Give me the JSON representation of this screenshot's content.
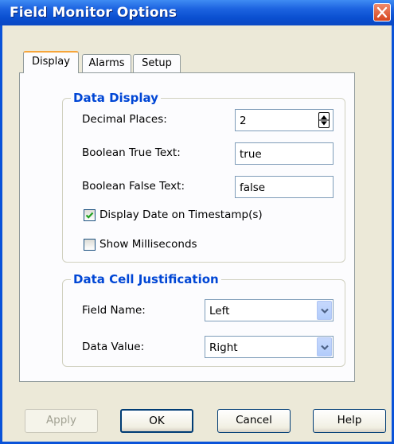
{
  "window": {
    "title": "Field Monitor Options"
  },
  "tabs": [
    {
      "label": "Display",
      "active": true
    },
    {
      "label": "Alarms",
      "active": false
    },
    {
      "label": "Setup",
      "active": false
    }
  ],
  "data_display": {
    "legend": "Data Display",
    "decimal_places": {
      "label": "Decimal Places:",
      "value": "2"
    },
    "bool_true": {
      "label": "Boolean True Text:",
      "value": "true"
    },
    "bool_false": {
      "label": "Boolean False Text:",
      "value": "false"
    },
    "display_date": {
      "label": "Display Date on Timestamp(s)",
      "checked": true
    },
    "show_ms": {
      "label": "Show Milliseconds",
      "checked": false
    }
  },
  "justification": {
    "legend": "Data Cell Justification",
    "field_name": {
      "label": "Field Name:",
      "value": "Left"
    },
    "data_value": {
      "label": "Data Value:",
      "value": "Right"
    }
  },
  "buttons": {
    "apply": "Apply",
    "ok": "OK",
    "cancel": "Cancel",
    "help": "Help"
  },
  "colors": {
    "titlebar": "#0a4fd0",
    "legend": "#0046d5",
    "checkmark": "#21a121",
    "dialog_bg": "#ece9d8"
  }
}
